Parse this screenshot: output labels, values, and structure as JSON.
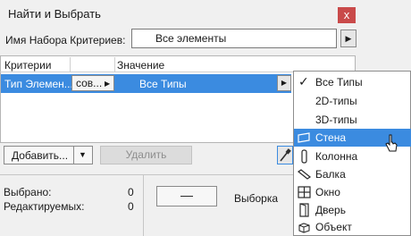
{
  "window": {
    "title": "Найти и Выбрать",
    "close_label": "x"
  },
  "criteria_set": {
    "label": "Имя Набора Критериев:",
    "selected": "Все элементы",
    "arrow": "▶"
  },
  "table": {
    "col_criteria": "Критерии",
    "col_value": "Значение",
    "row": {
      "name": "Тип Элемен...",
      "condition": "сов...",
      "condition_arrow": "▶",
      "value": "Все Типы",
      "value_arrow": "▶"
    }
  },
  "buttons": {
    "add": "Добавить...",
    "add_arrow": "▼",
    "delete": "Удалить",
    "minus": "—"
  },
  "stats": {
    "selected_label": "Выбрано:",
    "selected_value": "0",
    "editable_label": "Редактируемых:",
    "editable_value": "0",
    "selection_label": "Выборка"
  },
  "dropdown": {
    "check_glyph": "✓",
    "items": [
      {
        "label": "Все Типы",
        "icon": "check-icon"
      },
      {
        "label": "2D-типы",
        "icon": ""
      },
      {
        "label": "3D-типы",
        "icon": ""
      },
      {
        "label": "Стена",
        "icon": "wall-icon"
      },
      {
        "label": "Колонна",
        "icon": "column-icon"
      },
      {
        "label": "Балка",
        "icon": "beam-icon"
      },
      {
        "label": "Окно",
        "icon": "window-icon"
      },
      {
        "label": "Дверь",
        "icon": "door-icon"
      },
      {
        "label": "Объект",
        "icon": "object-icon"
      }
    ]
  },
  "colors": {
    "selection": "#3b8be0",
    "close_button": "#c94a4a"
  }
}
